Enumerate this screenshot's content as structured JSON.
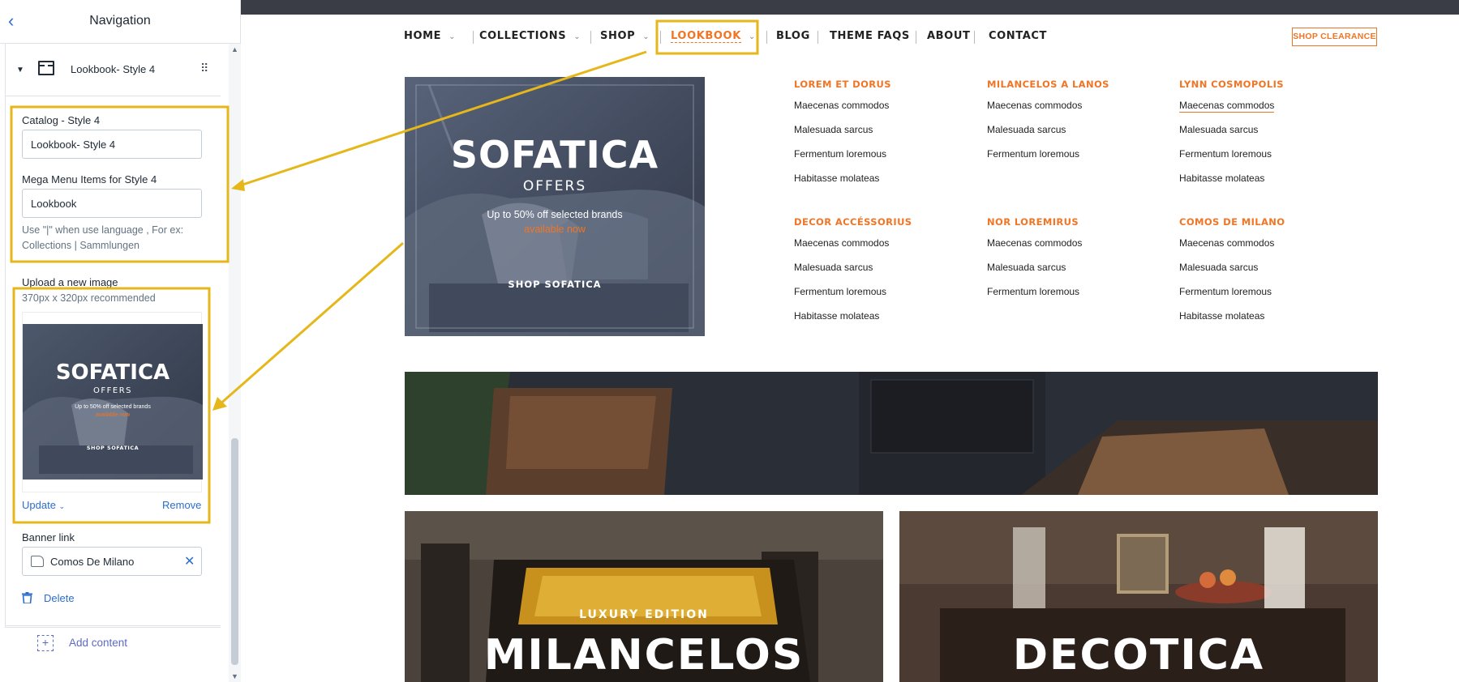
{
  "sidebar": {
    "title": "Navigation",
    "block_label": "Lookbook- Style 4",
    "catalog_label": "Catalog - Style 4",
    "catalog_value": "Lookbook- Style 4",
    "mega_label": "Mega Menu Items for Style 4",
    "mega_value": "Lookbook",
    "help_text": "Use \"|\" when use language , For ex: Collections | Sammlungen",
    "upload_label": "Upload a new image",
    "upload_hint": "370px x 320px recommended",
    "update_label": "Update",
    "remove_label": "Remove",
    "banner_link_label": "Banner link",
    "banner_link_value": "Comos De Milano",
    "delete_label": "Delete",
    "add_content_label": "Add content"
  },
  "thumb": {
    "title": "SOFATICA",
    "offers": "OFFERS",
    "line1": "Up to 50% off selected brands",
    "line2": "available now",
    "cta": "SHOP SOFATICA"
  },
  "nav": {
    "items": [
      {
        "label": "HOME"
      },
      {
        "label": "COLLECTIONS"
      },
      {
        "label": "SHOP"
      },
      {
        "label": "LOOKBOOK"
      },
      {
        "label": "BLOG"
      },
      {
        "label": "THEME FAQS"
      },
      {
        "label": "ABOUT"
      },
      {
        "label": "CONTACT"
      }
    ],
    "cta": "SHOP CLEARANCE"
  },
  "banner": {
    "title": "SOFATICA",
    "offers": "OFFERS",
    "line1": "Up to 50% off selected brands",
    "line2": "available now",
    "cta": "SHOP SOFATICA"
  },
  "menu": {
    "columns": [
      {
        "heading": "LOREM ET DORUS",
        "links": [
          "Maecenas commodos",
          "Malesuada sarcus",
          "Fermentum loremous",
          "Habitasse molateas"
        ]
      },
      {
        "heading": "MILANCELOS A LANOS",
        "links": [
          "Maecenas commodos",
          "Malesuada sarcus",
          "Fermentum loremous"
        ]
      },
      {
        "heading": "LYNN COSMOPOLIS",
        "links": [
          "Maecenas commodos",
          "Malesuada sarcus",
          "Fermentum loremous",
          "Habitasse molateas"
        ]
      },
      {
        "heading": "DECOR ACCÉSSORIUS",
        "links": [
          "Maecenas commodos",
          "Malesuada sarcus",
          "Fermentum loremous",
          "Habitasse molateas"
        ]
      },
      {
        "heading": "NOR LOREMIRUS",
        "links": [
          "Maecenas commodos",
          "Malesuada sarcus",
          "Fermentum loremous"
        ]
      },
      {
        "heading": "COMOS DE MILANO",
        "links": [
          "Maecenas commodos",
          "Malesuada sarcus",
          "Fermentum loremous",
          "Habitasse molateas"
        ]
      }
    ]
  },
  "tiles": {
    "left_sub": "LUXURY EDITION",
    "left_title": "MILANCELOS",
    "right_title": "DECOTICA"
  },
  "colors": {
    "accent": "#f07525",
    "highlight": "#e5b71a",
    "link_blue": "#2c6ecb"
  }
}
